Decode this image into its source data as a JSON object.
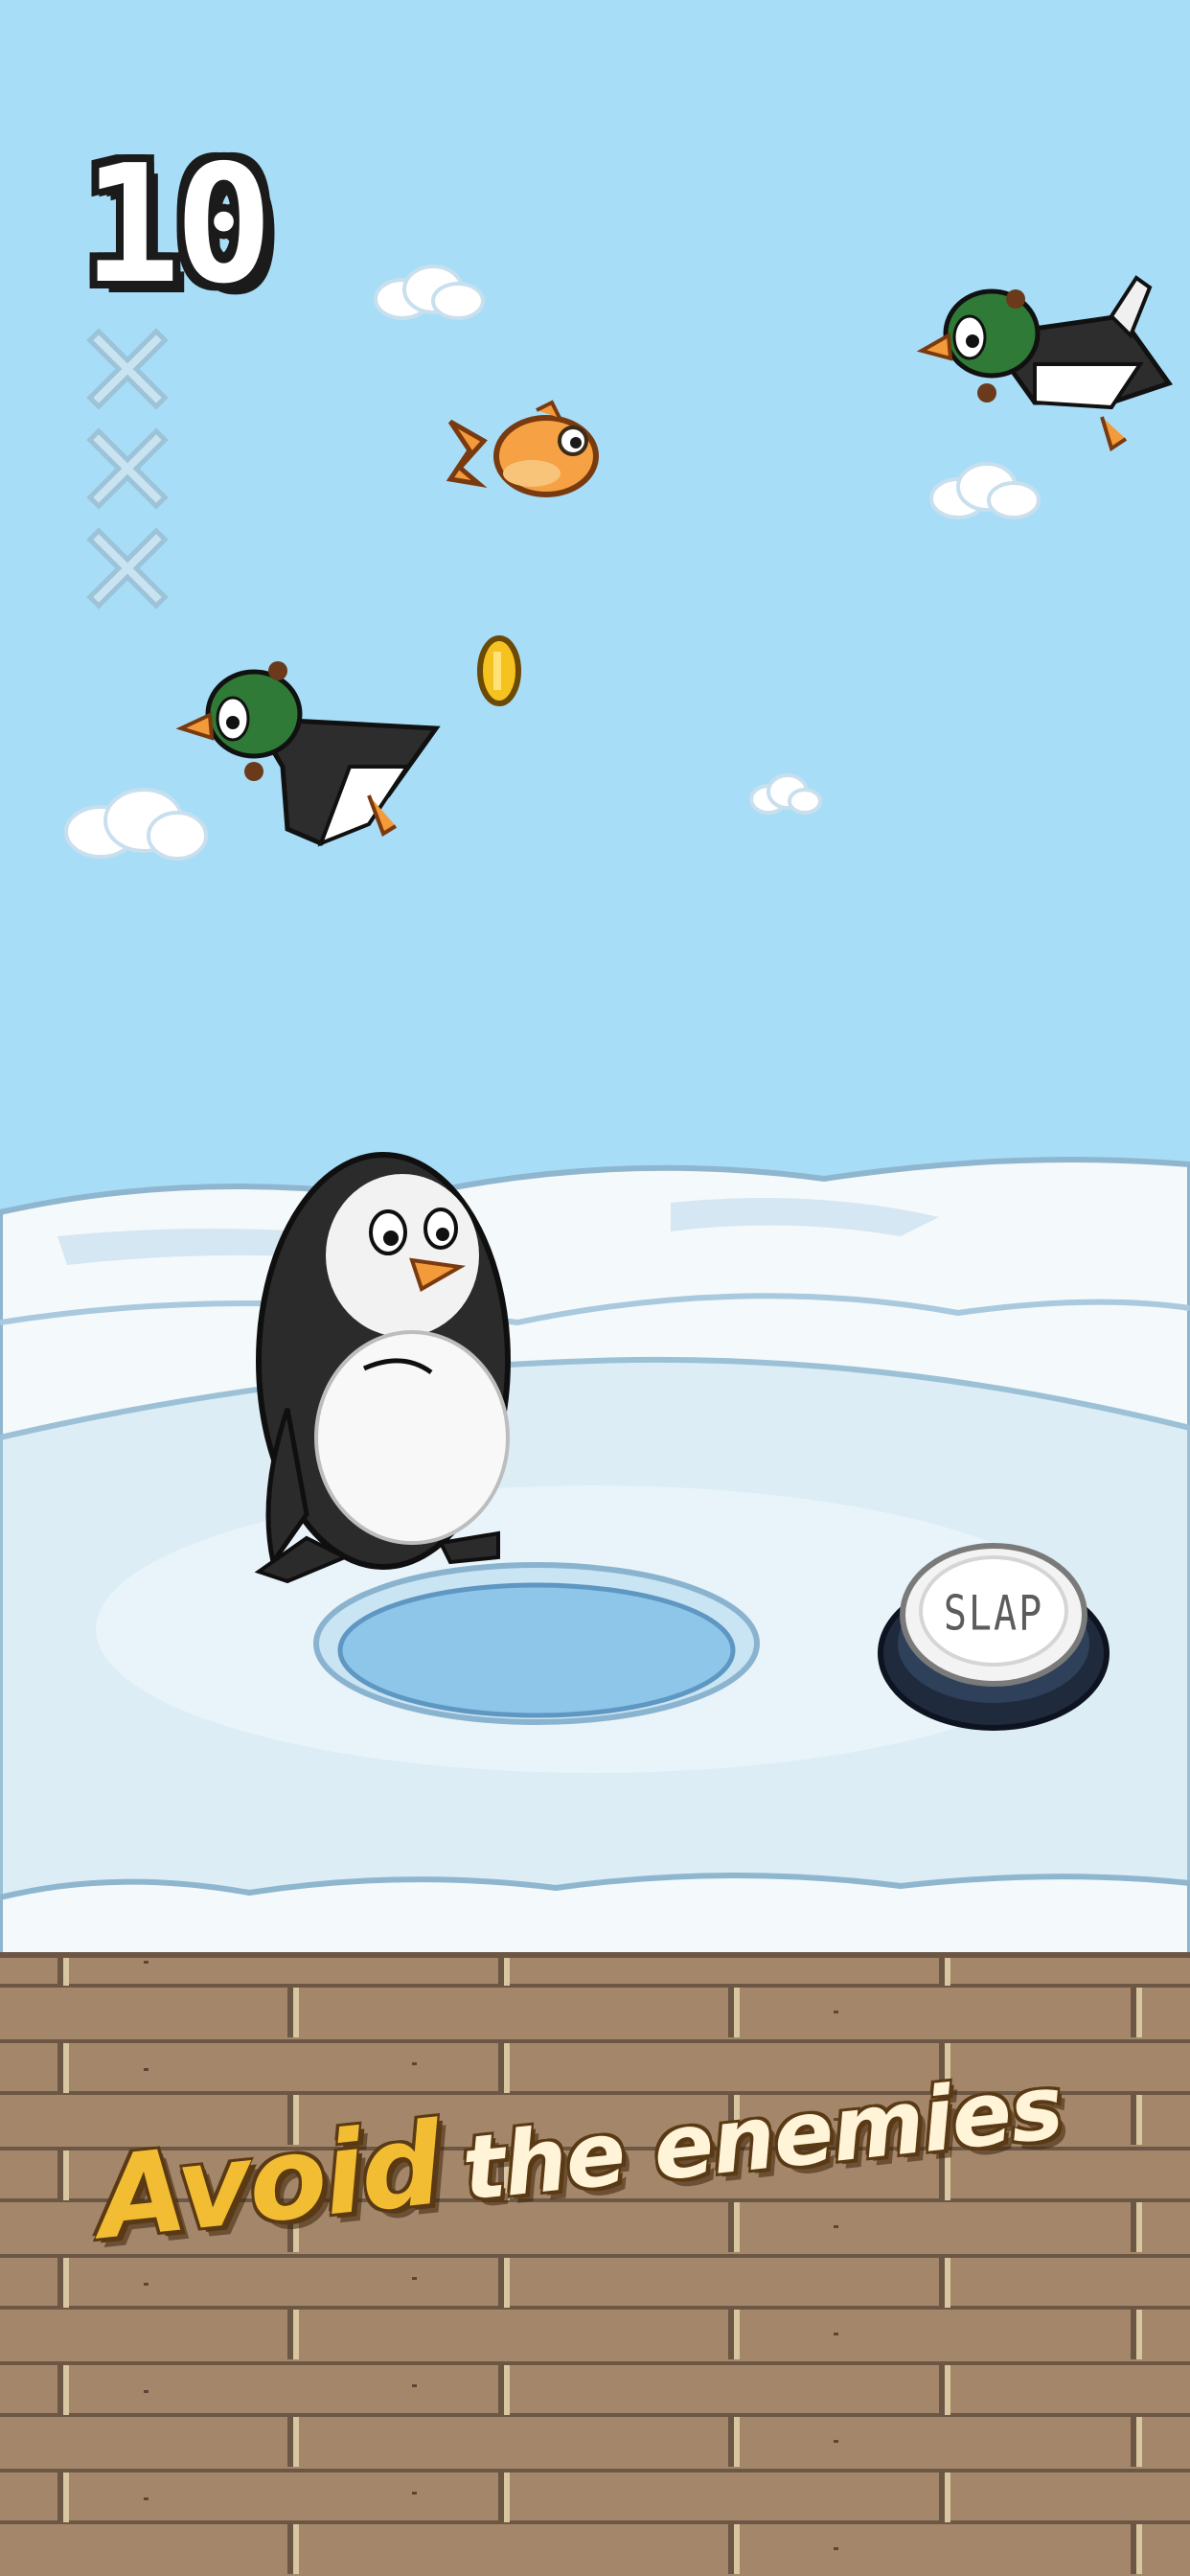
{
  "hud": {
    "score": "10",
    "lives_remaining_markers": 3,
    "life_icon": "x-mark-icon"
  },
  "controls": {
    "slap_label": "SLAP"
  },
  "caption": {
    "highlight": "Avoid",
    "rest": "the enemies"
  },
  "sprites": {
    "player": "penguin-player",
    "enemy": "flying-duck-enemy",
    "pickup_fish": "orange-fish",
    "pickup_coin": "gold-coin"
  },
  "colors": {
    "sky": "#a8ddf8",
    "snow": "#f4f9fc",
    "ice": "#dfeff6",
    "water": "#8ec6ea",
    "wood": "#a4876a",
    "caption_accent": "#f2bd33",
    "caption_text": "#fff3d8"
  }
}
